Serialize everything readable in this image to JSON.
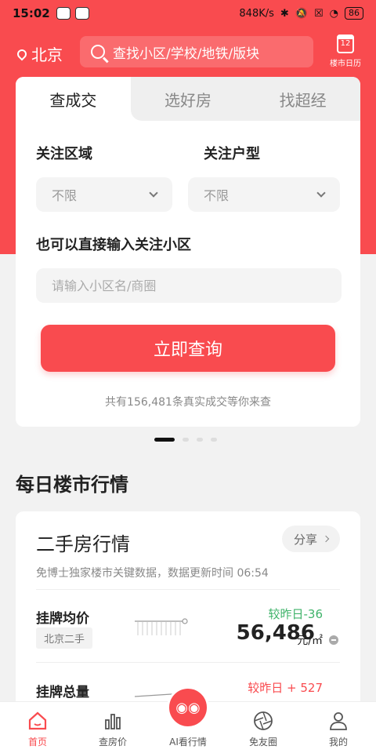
{
  "status_bar": {
    "time": "15:02",
    "network_speed": "848K/s",
    "battery": "86"
  },
  "header": {
    "city": "北京",
    "search_placeholder": "查找小区/学校/地铁/版块",
    "calendar_day": "12",
    "calendar_label": "楼市日历"
  },
  "query_card": {
    "tabs": [
      {
        "label": "查成交"
      },
      {
        "label": "选好房"
      },
      {
        "label": "找超经"
      }
    ],
    "area_label": "关注区域",
    "area_value": "不限",
    "type_label": "关注户型",
    "type_value": "不限",
    "community_label": "也可以直接输入关注小区",
    "community_placeholder": "请输入小区名/商圈",
    "button_label": "立即查询",
    "hint": "共有156,481条真实成交等你来查"
  },
  "section": {
    "title": "每日楼市行情"
  },
  "market": {
    "title": "二手房行情",
    "share_label": "分享",
    "subtitle": "免博士独家楼市关键数据，数据更新时间  06:54",
    "rows": [
      {
        "label": "挂牌均价",
        "tag": "北京二手",
        "change": "较昨日-36",
        "value": "56,486",
        "unit": "元/㎡"
      },
      {
        "label": "挂牌总量",
        "change": "较昨日 + 527"
      }
    ]
  },
  "tabbar": {
    "items": [
      {
        "label": "首页",
        "icon": "home-icon"
      },
      {
        "label": "查房价",
        "icon": "bar-chart-icon"
      },
      {
        "label": "AI看行情",
        "icon": "ai-mascot-icon"
      },
      {
        "label": "免友圈",
        "icon": "aperture-icon"
      },
      {
        "label": "我的",
        "icon": "user-icon"
      }
    ]
  },
  "colors": {
    "brand": "#f94b4f",
    "positive": "#3fb36a"
  }
}
